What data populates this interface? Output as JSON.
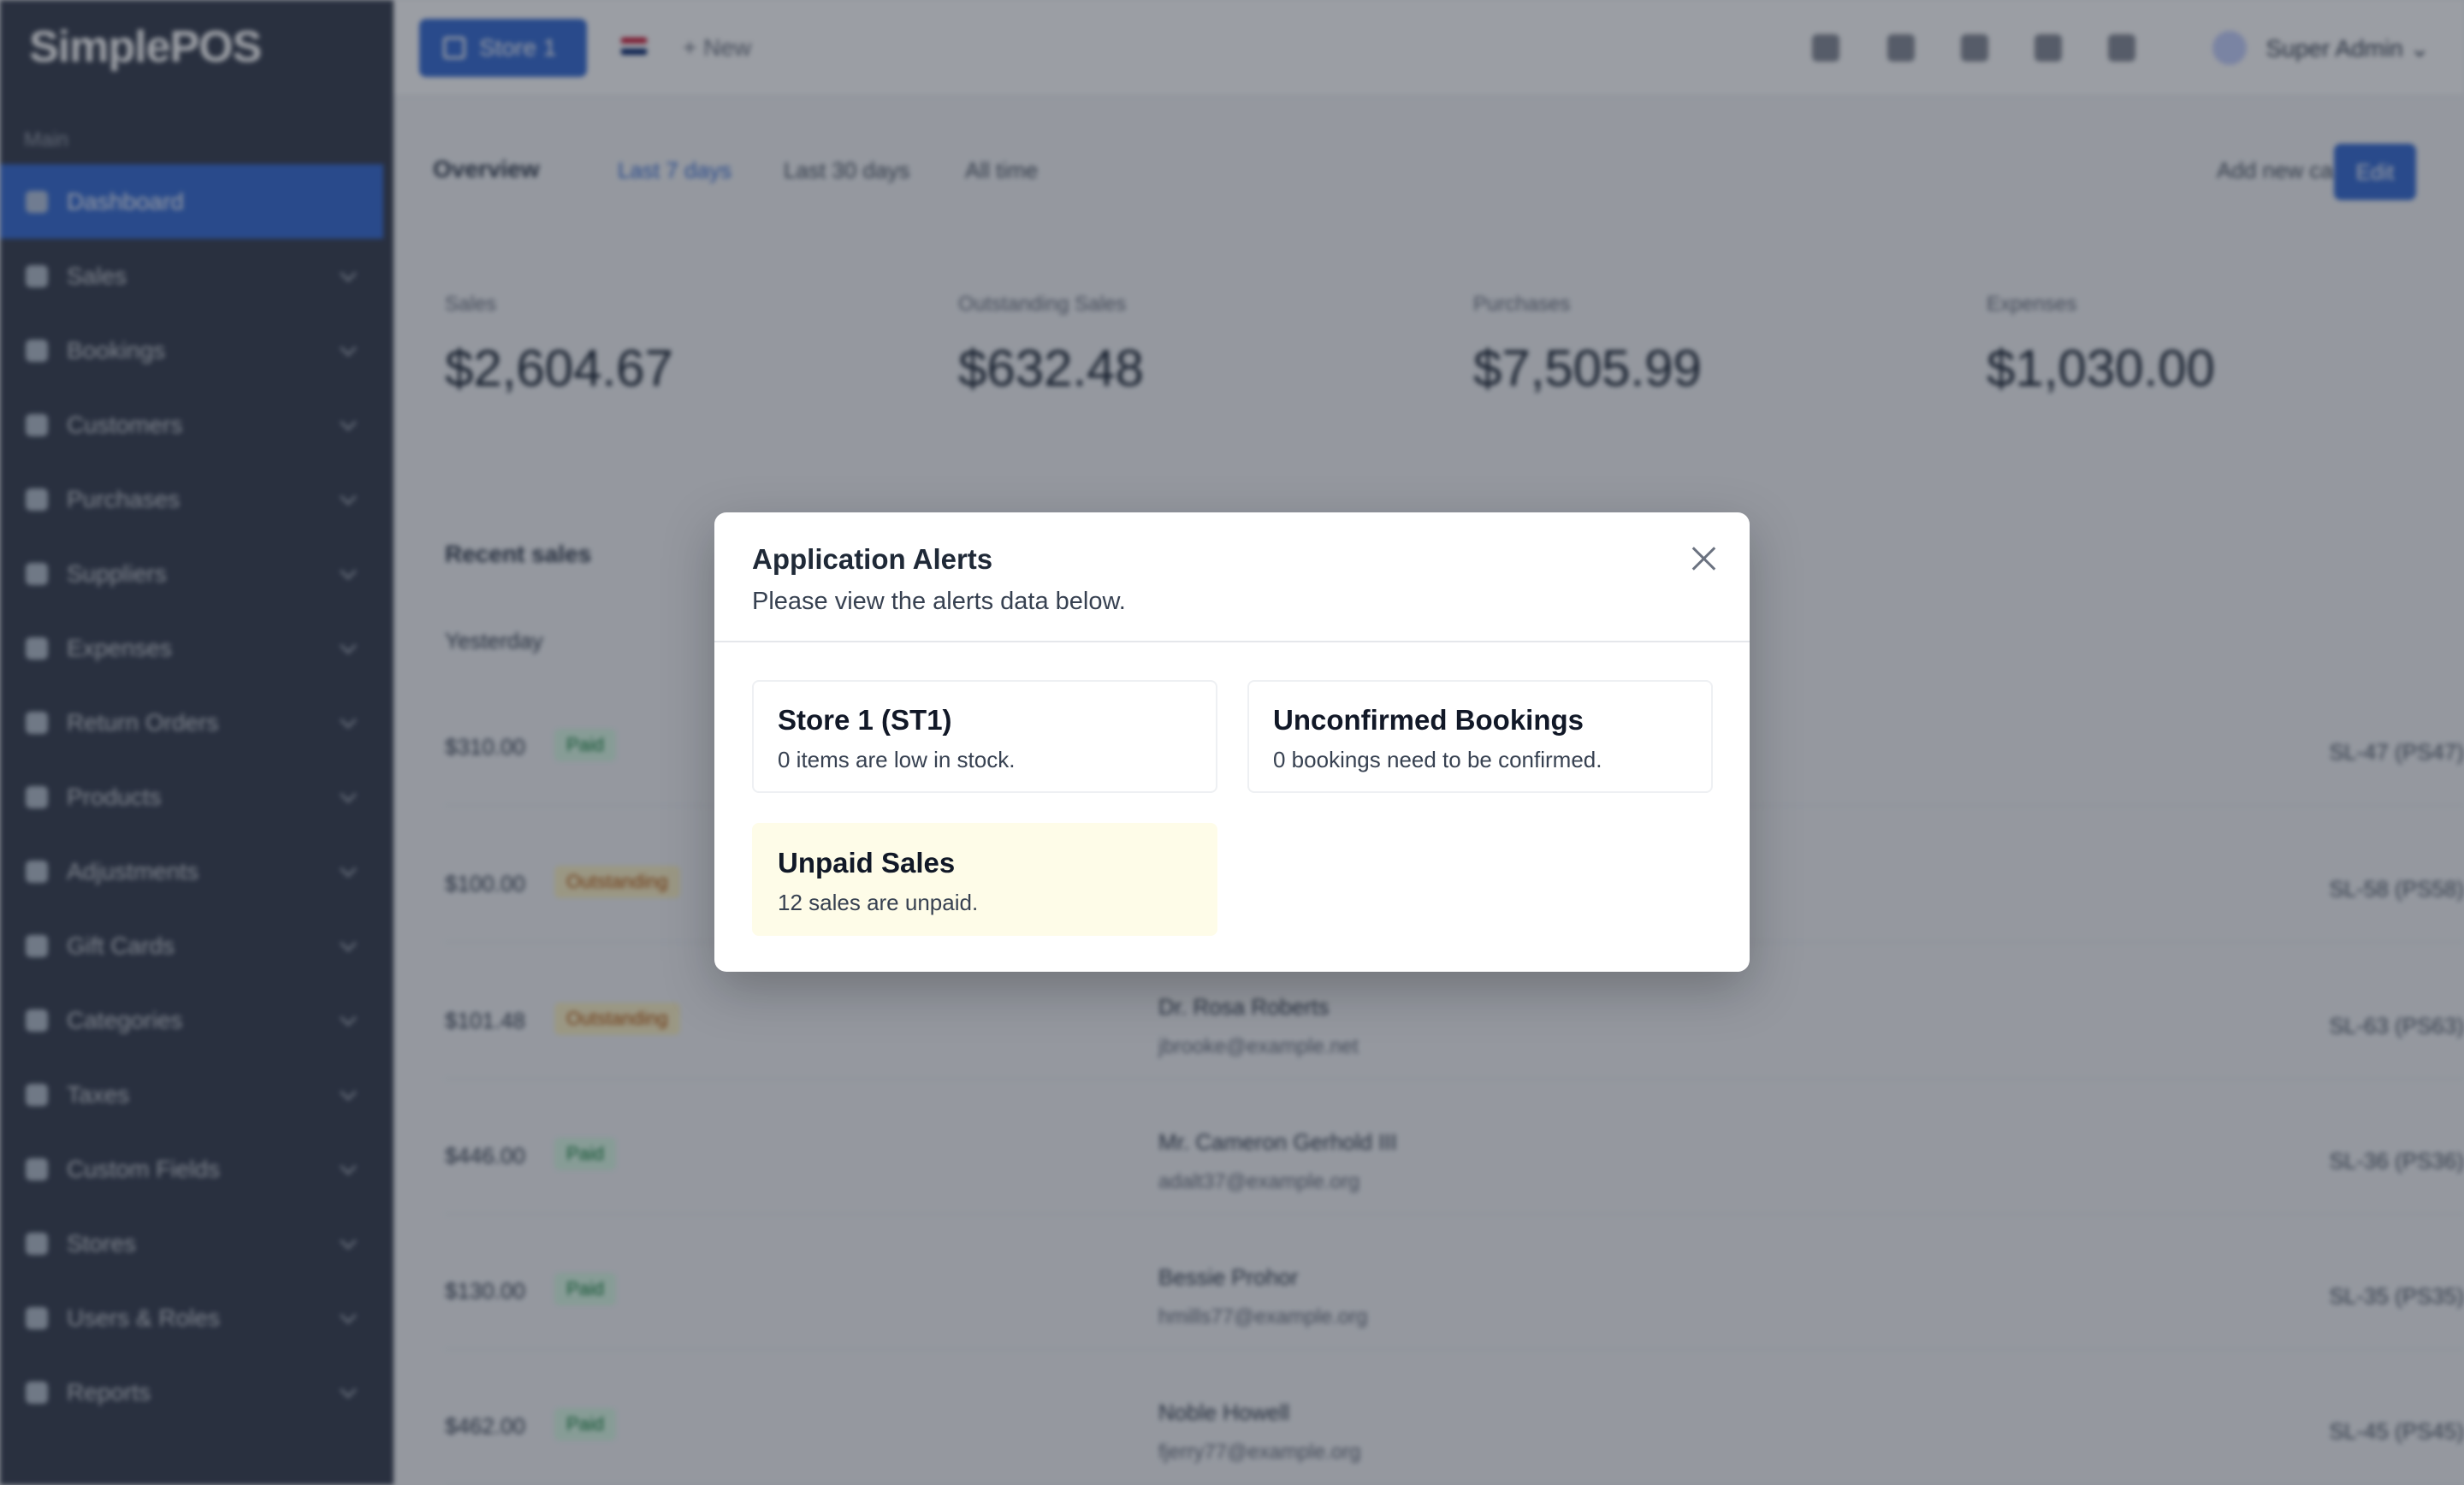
{
  "sidebar": {
    "brand": "SimplePOS",
    "heading": "Main",
    "items": [
      {
        "label": "Dashboard"
      },
      {
        "label": "Sales"
      },
      {
        "label": "Bookings"
      },
      {
        "label": "Customers"
      },
      {
        "label": "Purchases"
      },
      {
        "label": "Suppliers"
      },
      {
        "label": "Expenses"
      },
      {
        "label": "Return Orders"
      },
      {
        "label": "Products"
      },
      {
        "label": "Adjustments"
      },
      {
        "label": "Gift Cards"
      },
      {
        "label": "Categories"
      },
      {
        "label": "Taxes"
      },
      {
        "label": "Custom Fields"
      },
      {
        "label": "Stores"
      },
      {
        "label": "Users & Roles"
      },
      {
        "label": "Reports"
      }
    ]
  },
  "topbar": {
    "store_button": "Store 1",
    "new_button": "+ New",
    "user_name": "Super Admin ⌄"
  },
  "overview": {
    "title": "Overview",
    "tabs": [
      "Last 7 days",
      "Last 30 days",
      "All time"
    ],
    "add_card": "Add new card",
    "edit": "Edit"
  },
  "stats": [
    {
      "label": "Sales",
      "value": "$2,604.67"
    },
    {
      "label": "Outstanding Sales",
      "value": "$632.48"
    },
    {
      "label": "Purchases",
      "value": "$7,505.99"
    },
    {
      "label": "Expenses",
      "value": "$1,030.00"
    }
  ],
  "recent": {
    "title": "Recent sales",
    "day": "Yesterday",
    "rows": [
      {
        "amount": "$310.00",
        "status": "Paid",
        "status_type": "paid",
        "customer": "",
        "email": "",
        "ref": "SL-47 (PS47)"
      },
      {
        "amount": "$100.00",
        "status": "Outstanding",
        "status_type": "outstanding",
        "customer": "",
        "email": "",
        "ref": "SL-58 (PS58)"
      },
      {
        "amount": "$101.48",
        "status": "Outstanding",
        "status_type": "outstanding",
        "customer": "Dr. Rosa Roberts",
        "email": "jbrooke@example.net",
        "ref": "SL-63 (PS63)"
      },
      {
        "amount": "$446.00",
        "status": "Paid",
        "status_type": "paid",
        "customer": "Mr. Cameron Gerhold III",
        "email": "adalt37@example.org",
        "ref": "SL-36 (PS36)"
      },
      {
        "amount": "$130.00",
        "status": "Paid",
        "status_type": "paid",
        "customer": "Bessie Prohor",
        "email": "hmills77@example.org",
        "ref": "SL-35 (PS35)"
      },
      {
        "amount": "$462.00",
        "status": "Paid",
        "status_type": "paid",
        "customer": "Noble Howell",
        "email": "fjerry77@example.org",
        "ref": "SL-45 (PS45)"
      }
    ]
  },
  "modal": {
    "title": "Application Alerts",
    "subtitle": "Please view the alerts data below.",
    "alerts": [
      {
        "title": "Store 1 (ST1)",
        "text": "0 items are low in stock."
      },
      {
        "title": "Unconfirmed Bookings",
        "text": "0 bookings need to be confirmed."
      },
      {
        "title": "Unpaid Sales",
        "text": "12 sales are unpaid."
      }
    ]
  },
  "colors": {
    "accent": "#3b6fd4",
    "sidebar_bg": "#3b4252",
    "warning_card_bg": "#fefce8"
  }
}
